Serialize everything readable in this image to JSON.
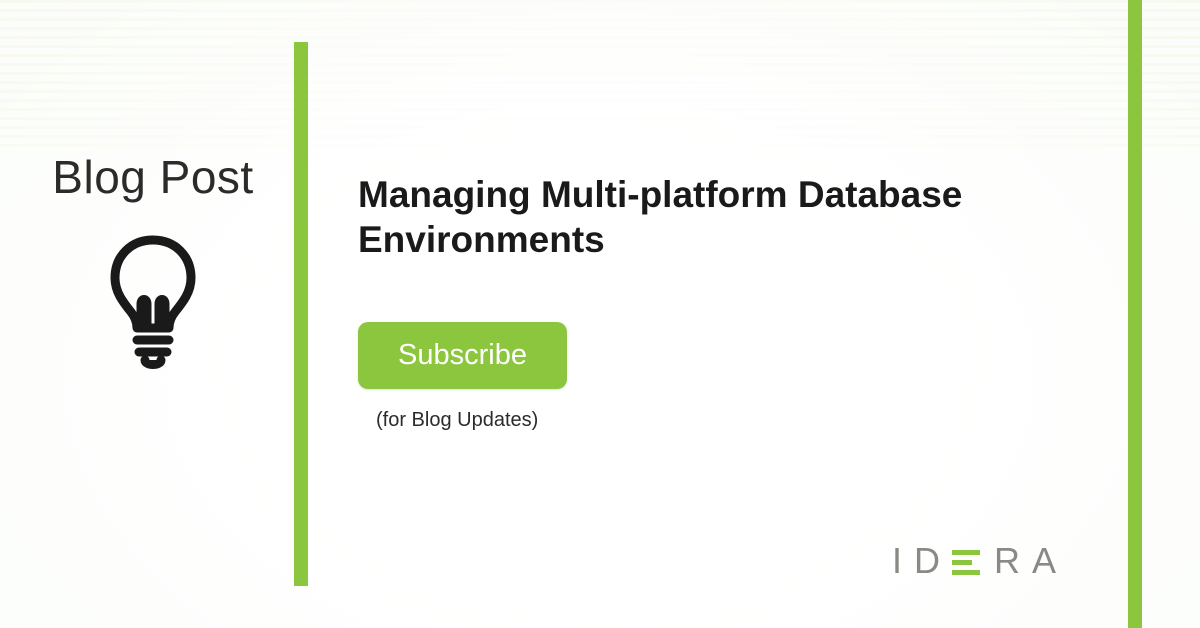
{
  "left": {
    "category_label": "Blog Post"
  },
  "main": {
    "title": "Managing Multi-platform Database Environments",
    "subscribe_label": "Subscribe",
    "subscribe_note": "(for Blog Updates)"
  },
  "brand": {
    "name": "IDERA",
    "accent_color": "#8cc63f"
  }
}
